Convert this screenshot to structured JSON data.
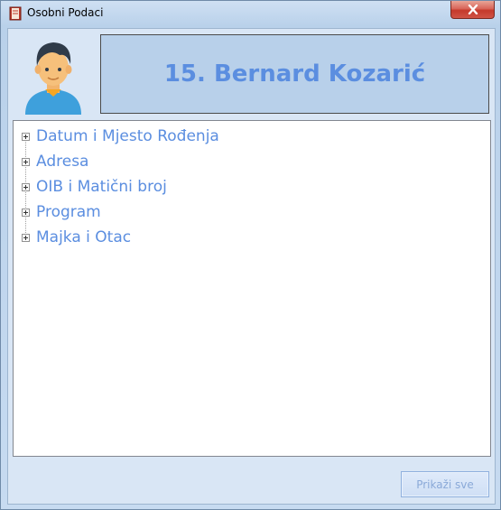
{
  "window": {
    "title": "Osobni Podaci",
    "icon": "book-icon"
  },
  "header": {
    "avatar_icon": "user-avatar-icon",
    "student_name": "15. Bernard Kozarić"
  },
  "tree": {
    "items": [
      {
        "label": "Datum i Mjesto Rođenja"
      },
      {
        "label": "Adresa"
      },
      {
        "label": "OIB i Matični broj"
      },
      {
        "label": "Program"
      },
      {
        "label": "Majka i Otac"
      }
    ]
  },
  "footer": {
    "show_all_label": "Prikaži sve"
  },
  "colors": {
    "accent_text": "#5b8ee0",
    "name_panel_bg": "#b8d0ea",
    "close_button": "#c4392b"
  }
}
